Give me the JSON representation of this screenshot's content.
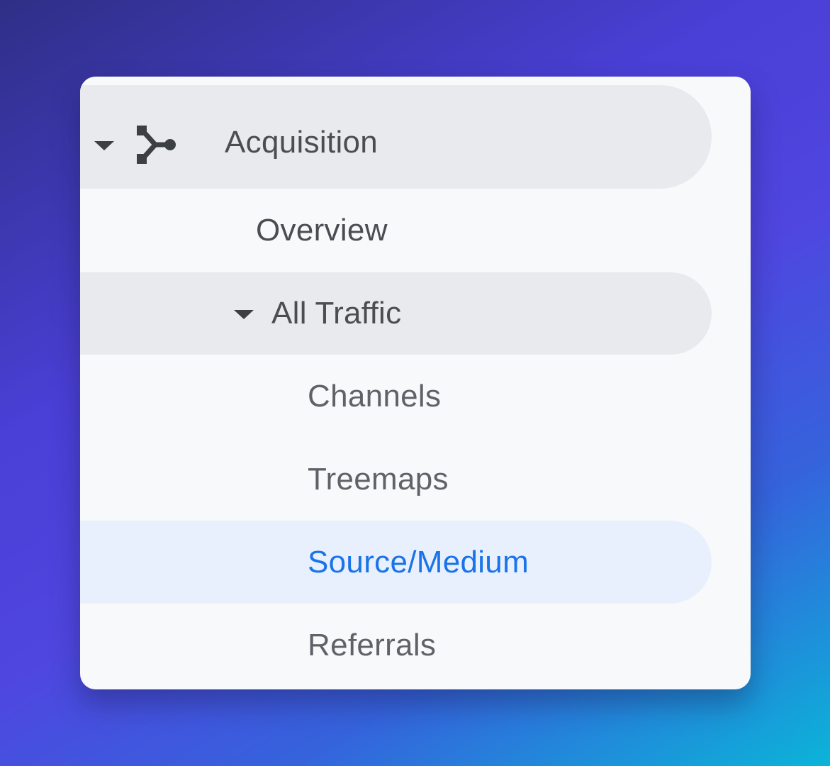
{
  "nav": {
    "section": {
      "label": "Acquisition",
      "icon": "merge-icon",
      "expanded": true
    },
    "items": [
      {
        "label": "Overview"
      },
      {
        "label": "All Traffic",
        "expanded": true
      },
      {
        "label": "Channels"
      },
      {
        "label": "Treemaps"
      },
      {
        "label": "Source/Medium",
        "active": true
      },
      {
        "label": "Referrals"
      }
    ],
    "colors": {
      "active_text": "#1a73e8",
      "active_bg": "#e8f0fe",
      "expanded_bg": "#e8eaed",
      "text": "#5f6368",
      "panel_bg": "#f8f9fa"
    }
  }
}
